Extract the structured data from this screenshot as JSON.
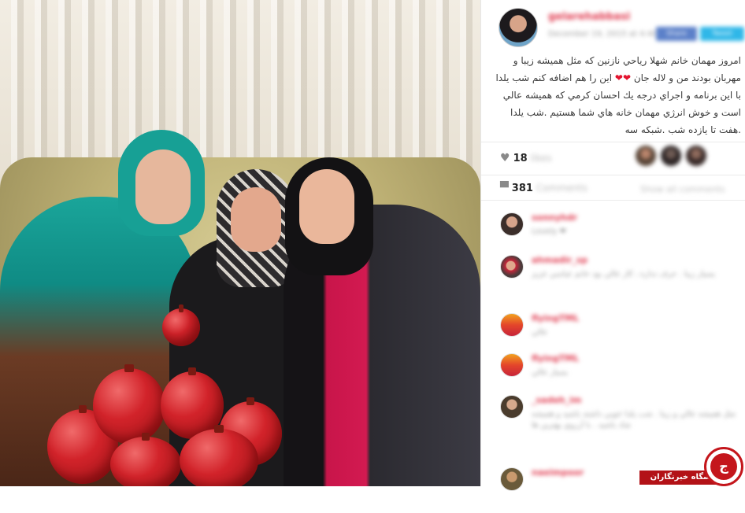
{
  "post": {
    "username": "gelarehabbasi",
    "date": "December 19, 2015 at 4:40",
    "share_facebook": "Share",
    "share_twitter": "Tweet",
    "caption_part1": "امروز مهمان خانم شهلا رياحي نازنين كه مثل هميشه زيبا و مهربان بودند من و لاله جان",
    "caption_hearts": "❤❤",
    "caption_part2": "اين را هم اضافه كنم شب يلدا با اين برنامه و اجراي درجه يك احسان كرمي كه هميشه عالي است و خوش انرژي مهمان خانه هاي شما هستيم .شب يلدا .هفت تا يازده شب .شبكه سه"
  },
  "stats": {
    "likes_count": "18",
    "likes_label": "likes",
    "comments_count": "381",
    "comments_label": "Comments",
    "show_all": "Show all comments"
  },
  "comments": [
    {
      "user": "sonnyhdr",
      "date": "",
      "text": "Lovely ❤"
    },
    {
      "user": "ahmadir_sp",
      "date": "",
      "text": "بسيار زيبا . حرف نداره ، كار عالي بود خانم عباسي عزيز"
    },
    {
      "user": "flyingTML",
      "date": "",
      "text": "عالي"
    },
    {
      "user": "flyingTML",
      "date": "",
      "text": "بسيار عالي"
    },
    {
      "user": "_sadeh_im",
      "date": "",
      "text": "مثل هميشه عالي و زيبا . شب يلدا خوبي داشته باشيد و هميشه شاد باشيد . با آرزوي بهترين ها"
    },
    {
      "user": "naeimpoor",
      "date": "",
      "text": ""
    }
  ],
  "brand": {
    "name": "باشگاه خبرنگاران",
    "logo_glyph": "ج"
  },
  "icons": [
    "heart-icon",
    "comment-icon"
  ],
  "colors": {
    "username": "#e03a4f",
    "heart": "#e3142f",
    "brand_red": "#b31217"
  }
}
